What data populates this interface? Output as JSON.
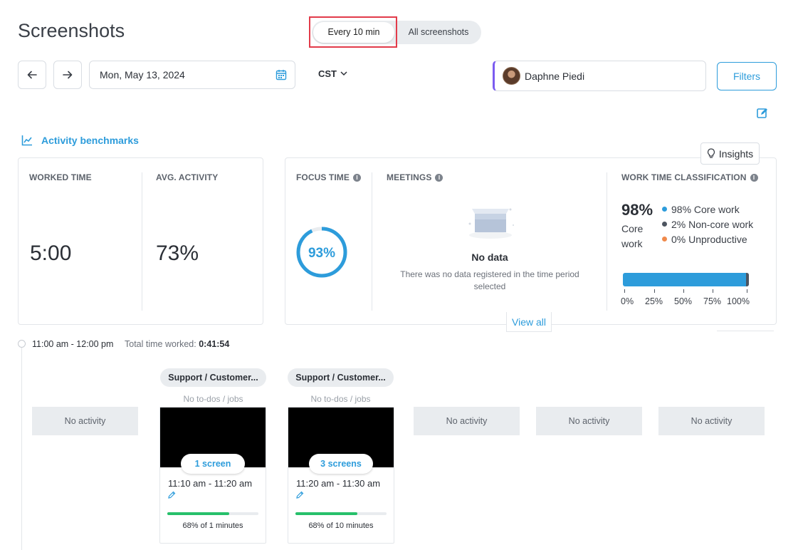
{
  "page": {
    "title": "Screenshots"
  },
  "view_toggle": {
    "active": "Every 10 min",
    "inactive": "All screenshots"
  },
  "toolbar": {
    "date": "Mon, May 13, 2024",
    "timezone": "CST",
    "user": "Daphne Piedi",
    "filters_label": "Filters"
  },
  "benchmarks": {
    "label": "Activity benchmarks"
  },
  "insights_label": "Insights",
  "stats": {
    "worked_time_label": "WORKED TIME",
    "worked_time": "5:00",
    "avg_activity_label": "AVG. ACTIVITY",
    "avg_activity": "73%",
    "focus_time_label": "FOCUS TIME",
    "focus_time_pct": "93%",
    "focus_time_value": 0.93,
    "meetings_label": "MEETINGS",
    "meetings_nodata_title": "No data",
    "meetings_nodata_sub": "There was no data registered in the time period selected",
    "wtc_label": "WORK TIME CLASSIFICATION",
    "wtc_pct": "98%",
    "wtc_sub1": "Core",
    "wtc_sub2": "work",
    "wtc_legend": [
      {
        "label": "98% Core work",
        "color": "#2d9cdb"
      },
      {
        "label": "2% Non-core work",
        "color": "#4d5560"
      },
      {
        "label": "0% Unproductive",
        "color": "#f08a4b"
      }
    ],
    "wtc_ticks": [
      "0%",
      "25%",
      "50%",
      "75%",
      "100%"
    ],
    "view_all": "View all"
  },
  "timeline": {
    "range": "11:00 am - 12:00 pm",
    "total_label": "Total time worked:",
    "total_value": "0:41:54",
    "no_activity": "No activity",
    "slots": [
      {
        "project": "Support / Customer...",
        "todo": "No to-dos / jobs",
        "screens": "1 screen",
        "time": "11:10 am - 11:20 am",
        "activity": 0.68,
        "activity_text": "68% of 1 minutes"
      },
      {
        "project": "Support / Customer...",
        "todo": "No to-dos / jobs",
        "screens": "3 screens",
        "time": "11:20 am - 11:30 am",
        "activity": 0.68,
        "activity_text": "68% of 10 minutes"
      }
    ]
  }
}
